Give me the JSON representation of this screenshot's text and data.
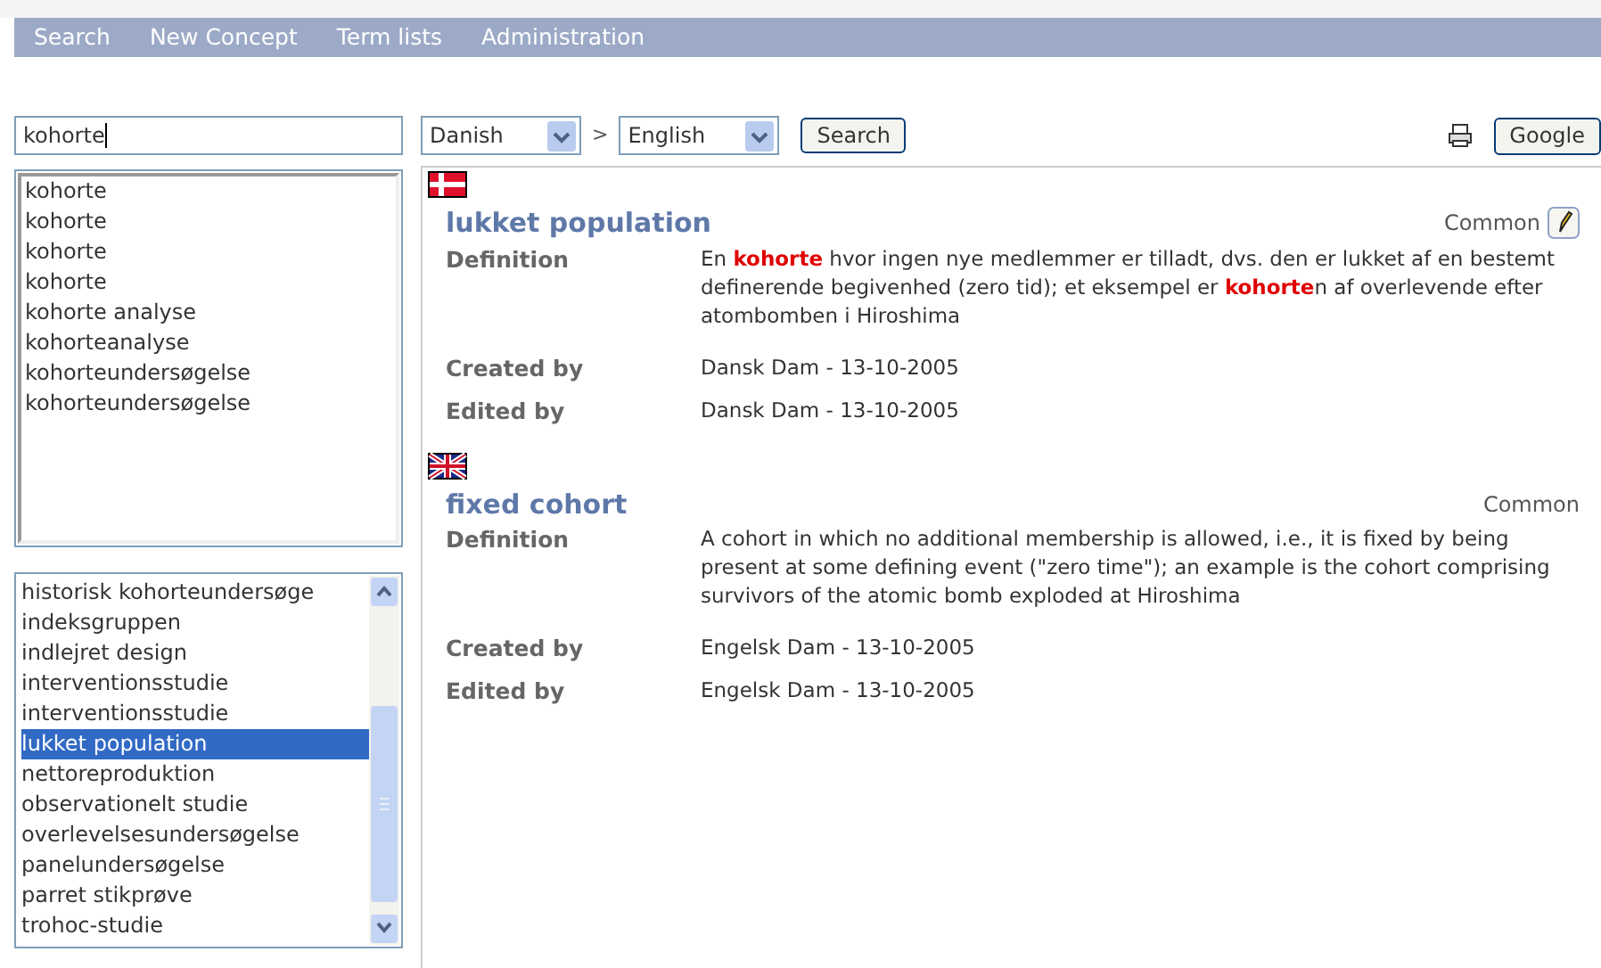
{
  "nav": [
    "Search",
    "New Concept",
    "Term lists",
    "Administration"
  ],
  "search": {
    "value": "kohorte"
  },
  "matches": [
    "kohorte",
    "kohorte",
    "kohorte",
    "kohorte",
    "kohorte analyse",
    "kohorteanalyse",
    "kohorteundersøgelse",
    "kohorteundersøgelse"
  ],
  "terms": [
    {
      "label": "historisk kohorteundersøge",
      "selected": false
    },
    {
      "label": "indeksgruppen",
      "selected": false
    },
    {
      "label": "indlejret design",
      "selected": false
    },
    {
      "label": "interventionsstudie",
      "selected": false
    },
    {
      "label": "interventionsstudie",
      "selected": false
    },
    {
      "label": "lukket population",
      "selected": true
    },
    {
      "label": "nettoreproduktion",
      "selected": false
    },
    {
      "label": "observationelt studie",
      "selected": false
    },
    {
      "label": "overlevelsesundersøgelse",
      "selected": false
    },
    {
      "label": "panelundersøgelse",
      "selected": false
    },
    {
      "label": "parret stikprøve",
      "selected": false
    },
    {
      "label": "trohoc-studie",
      "selected": false
    }
  ],
  "toolbar": {
    "from": "Danish",
    "separator": ">",
    "to": "English",
    "search_button": "Search",
    "google_button": "Google"
  },
  "entries": [
    {
      "kind": "danish",
      "term": "lukket population",
      "status": "Common",
      "editable": true,
      "fields": [
        {
          "label": "Definition",
          "value": "En **kohorte** hvor ingen nye medlemmer er tilladt, dvs. den er lukket af en bestemt definerende begivenhed (zero tid); et eksempel er **kohorte**n af overlevende efter atombomben i Hiroshima"
        },
        {
          "label": "Created by",
          "value": "Dansk Dam - 13-10-2005"
        },
        {
          "label": "Edited by",
          "value": "Dansk Dam - 13-10-2005"
        }
      ]
    },
    {
      "kind": "british",
      "term": "fixed cohort",
      "status": "Common",
      "editable": false,
      "fields": [
        {
          "label": "Definition",
          "value": "A cohort in which no additional membership is allowed, i.e., it is fixed by being present at some defining event (\"zero time\"); an example is the cohort comprising survivors of the atomic bomb exploded at Hiroshima"
        },
        {
          "label": "Created by",
          "value": "Engelsk Dam - 13-10-2005"
        },
        {
          "label": "Edited by",
          "value": "Engelsk Dam - 13-10-2005"
        }
      ]
    }
  ]
}
